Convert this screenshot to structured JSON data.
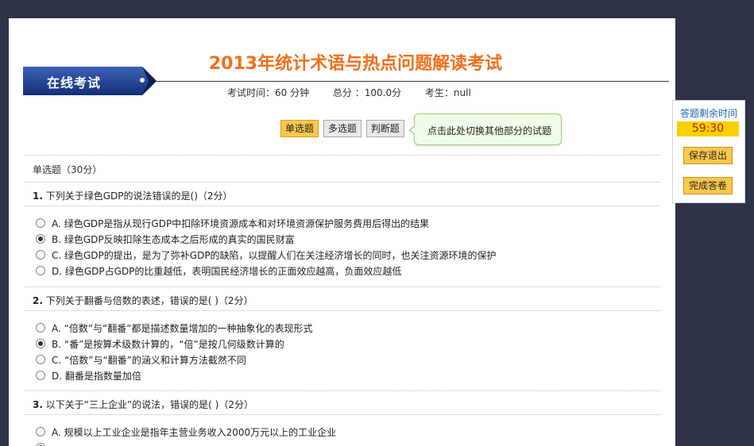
{
  "header": {
    "title": "2013年统计术语与热点问题解读考试",
    "banner": "在线考试",
    "duration": "考试时间：60 分钟",
    "total": "总分 ：100.0分",
    "examinee": "考生：null"
  },
  "tabs": [
    {
      "label": "单选题",
      "active": true
    },
    {
      "label": "多选题",
      "active": false
    },
    {
      "label": "判断题",
      "active": false
    }
  ],
  "tip": "点击此处切换其他部分的试题",
  "section_title": "单选题（30分）",
  "questions": [
    {
      "number": "1.",
      "text": "下列关于绿色GDP的说法错误的是()（2分）",
      "options": [
        "A. 绿色GDP是指从现行GDP中扣除环境资源成本和对环境资源保护服务费用后得出的结果",
        "B. 绿色GDP反映扣除生态成本之后形成的真实的国民财富",
        "C. 绿色GDP的提出，是为了弥补GDP的缺陷，以提醒人们在关注经济增长的同时，也关注资源环境的保护",
        "D. 绿色GDP占GDP的比重越低，表明国民经济增长的正面效应越高，负面效应越低"
      ],
      "selected": 1
    },
    {
      "number": "2.",
      "text": "下列关于翻番与倍数的表述，错误的是( )（2分）",
      "options": [
        "A. “倍数”与“翻番”都是描述数量增加的一种抽象化的表现形式",
        "B. “番”是按算术级数计算的，“倍”是按几何级数计算的",
        "C. “倍数”与“翻番”的涵义和计算方法截然不同",
        "D. 翻番是指数量加倍"
      ],
      "selected": 1
    },
    {
      "number": "3.",
      "text": "以下关于“三上企业”的说法，错误的是( )（2分）",
      "options": [
        "A. 规模以上工业企业是指年主营业务收入2000万元以上的工业企业"
      ],
      "selected": -1
    }
  ],
  "sidebar": {
    "label": "答题剩余时间",
    "timer": "59:30",
    "save_exit": "保存退出",
    "finish": "完成答卷"
  },
  "colors": {
    "title": "#f26f1a",
    "banner": "#1a3f8c",
    "button": "#fbc84c",
    "timer_bg": "#f7d100",
    "timer_text": "#c0181d"
  }
}
